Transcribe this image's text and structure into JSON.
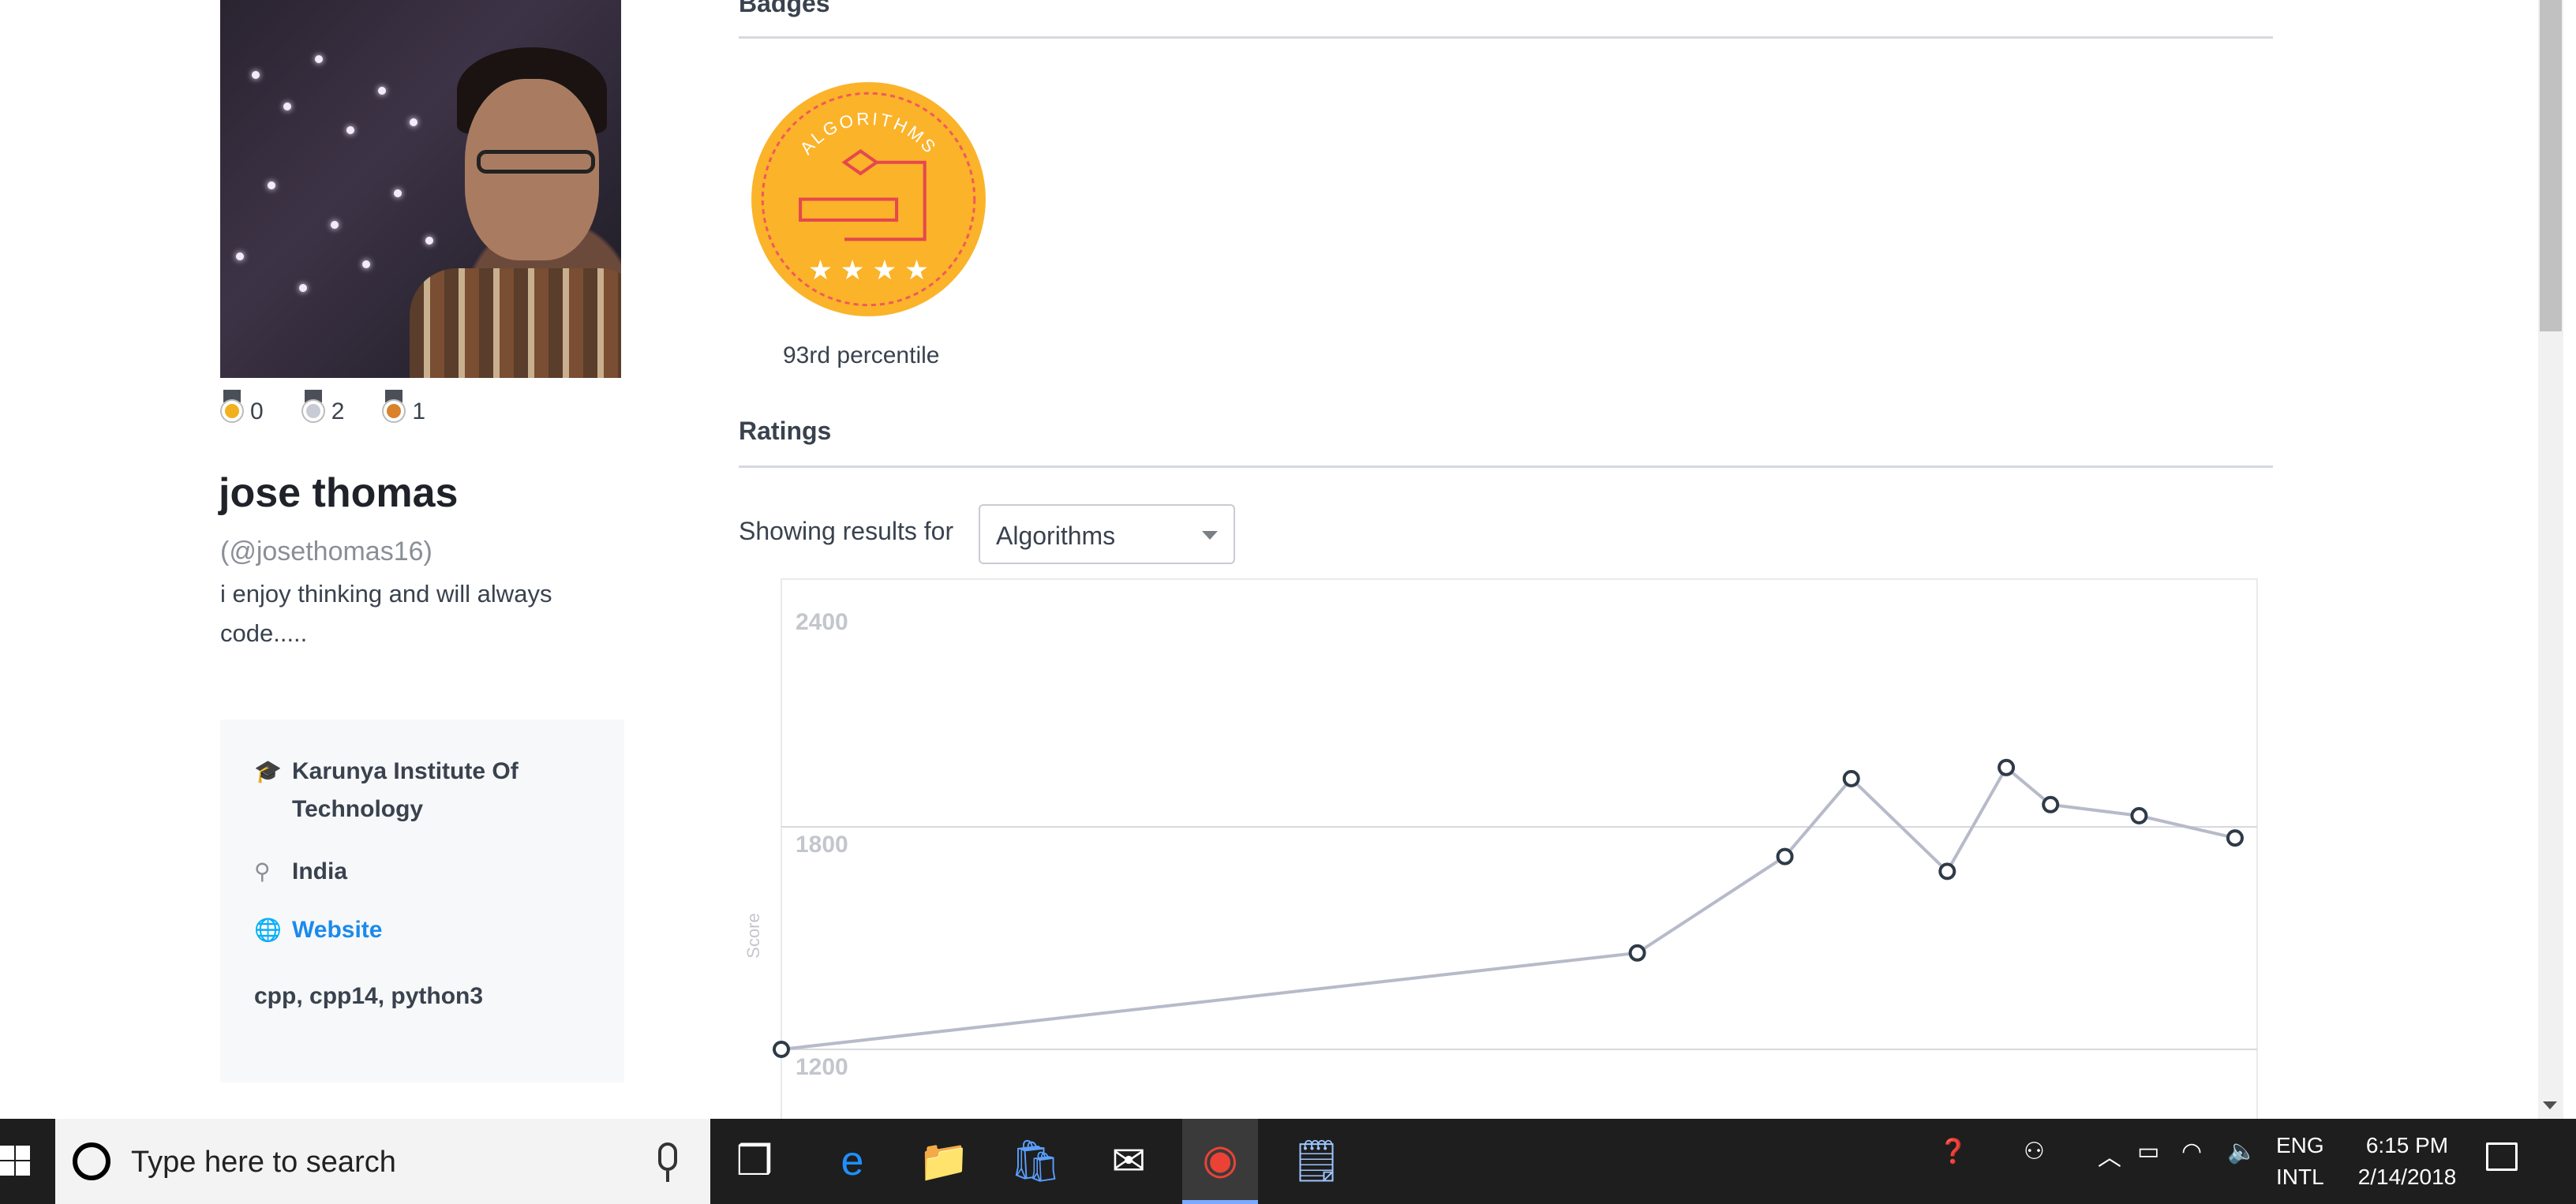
{
  "profile": {
    "name": "jose thomas",
    "handle": "(@josethomas16)",
    "bio": "i enjoy thinking and will always code.....",
    "medals": [
      {
        "kind": "gold",
        "count": "0",
        "color": "#f2b01e"
      },
      {
        "kind": "silver",
        "count": "2",
        "color": "#c7ccd4"
      },
      {
        "kind": "bronze",
        "count": "1",
        "color": "#d9822b"
      }
    ],
    "info": {
      "school": "Karunya Institute Of Technology",
      "location": "India",
      "website_label": "Website",
      "languages": "cpp, cpp14, python3"
    }
  },
  "badges": {
    "section_title": "Badges",
    "items": [
      {
        "name": "ALGORITHMS",
        "stars": 4,
        "caption": "93rd percentile",
        "color": "#fbb32a"
      }
    ]
  },
  "ratings": {
    "section_title": "Ratings",
    "showing_label": "Showing results for",
    "selected_track": "Algorithms"
  },
  "chart_data": {
    "type": "line",
    "ylabel": "Score",
    "yticks": [
      "2400",
      "1800",
      "1200"
    ],
    "ylim": [
      1200,
      2400
    ],
    "grid": true,
    "series": [
      {
        "values": [
          1200,
          1460,
          1720,
          1930,
          1680,
          1960,
          1860,
          1830,
          1770
        ]
      }
    ],
    "x": [
      0.0,
      0.58,
      0.68,
      0.725,
      0.79,
      0.83,
      0.86,
      0.92,
      0.985
    ],
    "line_color": "#b7bac9",
    "point_color": "#2f3a47"
  },
  "taskbar": {
    "search_placeholder": "Type here to search",
    "apps": [
      {
        "name": "task-view-icon",
        "glyph": "❒"
      },
      {
        "name": "edge-icon",
        "glyph": "e"
      },
      {
        "name": "file-explorer-icon",
        "glyph": "📁"
      },
      {
        "name": "store-icon",
        "glyph": "🛍"
      },
      {
        "name": "mail-icon",
        "glyph": "✉"
      },
      {
        "name": "chrome-icon",
        "glyph": "◉"
      },
      {
        "name": "notepad-icon",
        "glyph": "🗒"
      }
    ],
    "lang_line1": "ENG",
    "lang_line2": "INTL",
    "time": "6:15 PM",
    "date": "2/14/2018"
  }
}
